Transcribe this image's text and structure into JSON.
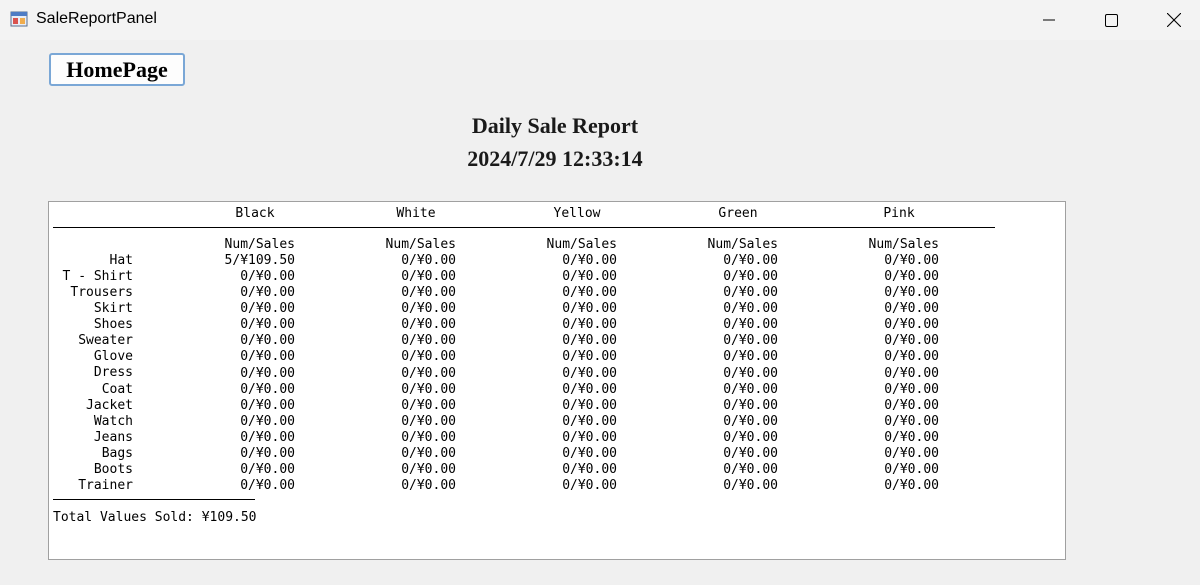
{
  "window": {
    "title": "SaleReportPanel",
    "controls": {
      "minimize": "minimize",
      "maximize": "maximize",
      "close": "close"
    }
  },
  "home_button": {
    "label": "HomePage"
  },
  "report": {
    "title": "Daily Sale Report",
    "date": "2024/7/29 12:33:14",
    "colors": [
      "Black",
      "White",
      "Yellow",
      "Green",
      "Pink"
    ],
    "subheader": "Num/Sales",
    "products": [
      "Hat",
      "T - Shirt",
      "Trousers",
      "Skirt",
      "Shoes",
      "Sweater",
      "Glove",
      "Dress",
      "Coat",
      "Jacket",
      "Watch",
      "Jeans",
      "Bags",
      "Boots",
      "Trainer"
    ],
    "values": {
      "Black": [
        "5/¥109.50",
        "0/¥0.00",
        "0/¥0.00",
        "0/¥0.00",
        "0/¥0.00",
        "0/¥0.00",
        "0/¥0.00",
        "0/¥0.00",
        "0/¥0.00",
        "0/¥0.00",
        "0/¥0.00",
        "0/¥0.00",
        "0/¥0.00",
        "0/¥0.00",
        "0/¥0.00"
      ],
      "White": [
        "0/¥0.00",
        "0/¥0.00",
        "0/¥0.00",
        "0/¥0.00",
        "0/¥0.00",
        "0/¥0.00",
        "0/¥0.00",
        "0/¥0.00",
        "0/¥0.00",
        "0/¥0.00",
        "0/¥0.00",
        "0/¥0.00",
        "0/¥0.00",
        "0/¥0.00",
        "0/¥0.00"
      ],
      "Yellow": [
        "0/¥0.00",
        "0/¥0.00",
        "0/¥0.00",
        "0/¥0.00",
        "0/¥0.00",
        "0/¥0.00",
        "0/¥0.00",
        "0/¥0.00",
        "0/¥0.00",
        "0/¥0.00",
        "0/¥0.00",
        "0/¥0.00",
        "0/¥0.00",
        "0/¥0.00",
        "0/¥0.00"
      ],
      "Green": [
        "0/¥0.00",
        "0/¥0.00",
        "0/¥0.00",
        "0/¥0.00",
        "0/¥0.00",
        "0/¥0.00",
        "0/¥0.00",
        "0/¥0.00",
        "0/¥0.00",
        "0/¥0.00",
        "0/¥0.00",
        "0/¥0.00",
        "0/¥0.00",
        "0/¥0.00",
        "0/¥0.00"
      ],
      "Pink": [
        "0/¥0.00",
        "0/¥0.00",
        "0/¥0.00",
        "0/¥0.00",
        "0/¥0.00",
        "0/¥0.00",
        "0/¥0.00",
        "0/¥0.00",
        "0/¥0.00",
        "0/¥0.00",
        "0/¥0.00",
        "0/¥0.00",
        "0/¥0.00",
        "0/¥0.00",
        "0/¥0.00"
      ]
    },
    "total_label": "Total Values Sold:",
    "total_value": "¥109.50"
  }
}
